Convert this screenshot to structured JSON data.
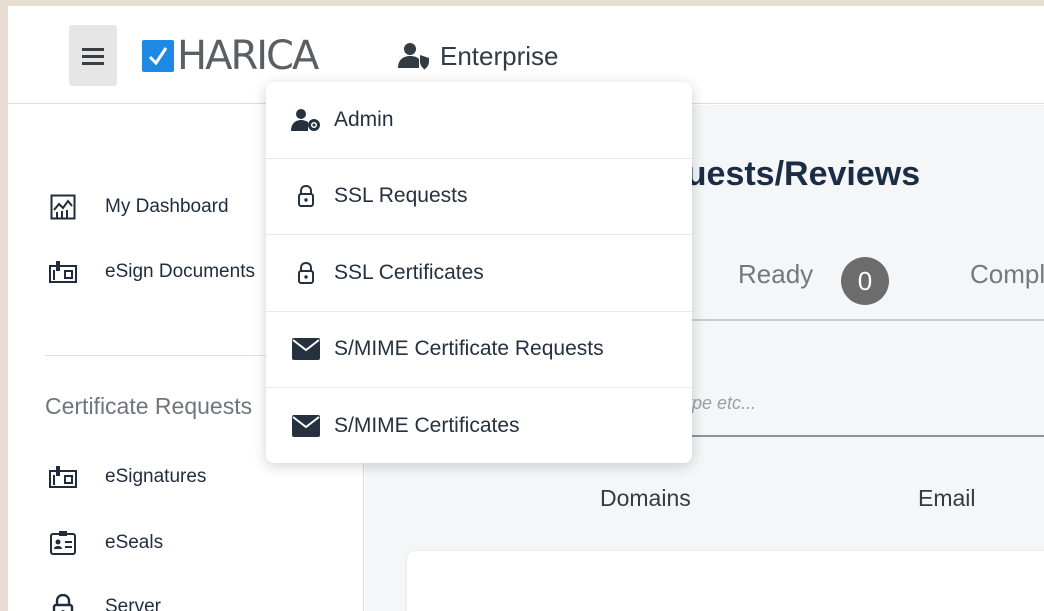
{
  "header": {
    "logo_text": "HARICA",
    "menu_label": "Enterprise"
  },
  "dropdown": {
    "items": [
      {
        "label": "Admin",
        "icon": "user-gear-icon"
      },
      {
        "label": "SSL Requests",
        "icon": "lock-icon"
      },
      {
        "label": "SSL Certificates",
        "icon": "lock-icon"
      },
      {
        "label": "S/MIME Certificate Requests",
        "icon": "envelope-icon"
      },
      {
        "label": "S/MIME Certificates",
        "icon": "envelope-icon"
      }
    ]
  },
  "sidebar": {
    "items": [
      {
        "label": "My Dashboard",
        "icon": "dashboard-chart-icon"
      },
      {
        "label": "eSign Documents",
        "icon": "esign-icon"
      }
    ],
    "section_title": "Certificate Requests",
    "section_items": [
      {
        "label": "eSignatures",
        "icon": "esign-icon"
      },
      {
        "label": "eSeals",
        "icon": "id-card-icon"
      },
      {
        "label": "Server",
        "icon": "lock-icon"
      }
    ]
  },
  "main": {
    "title": "quests/Reviews",
    "tabs": [
      {
        "label": "Ready",
        "count": "0"
      },
      {
        "label": "Compl"
      }
    ],
    "search_placeholder": "ype etc...",
    "columns": [
      "Domains",
      "Email"
    ]
  }
}
